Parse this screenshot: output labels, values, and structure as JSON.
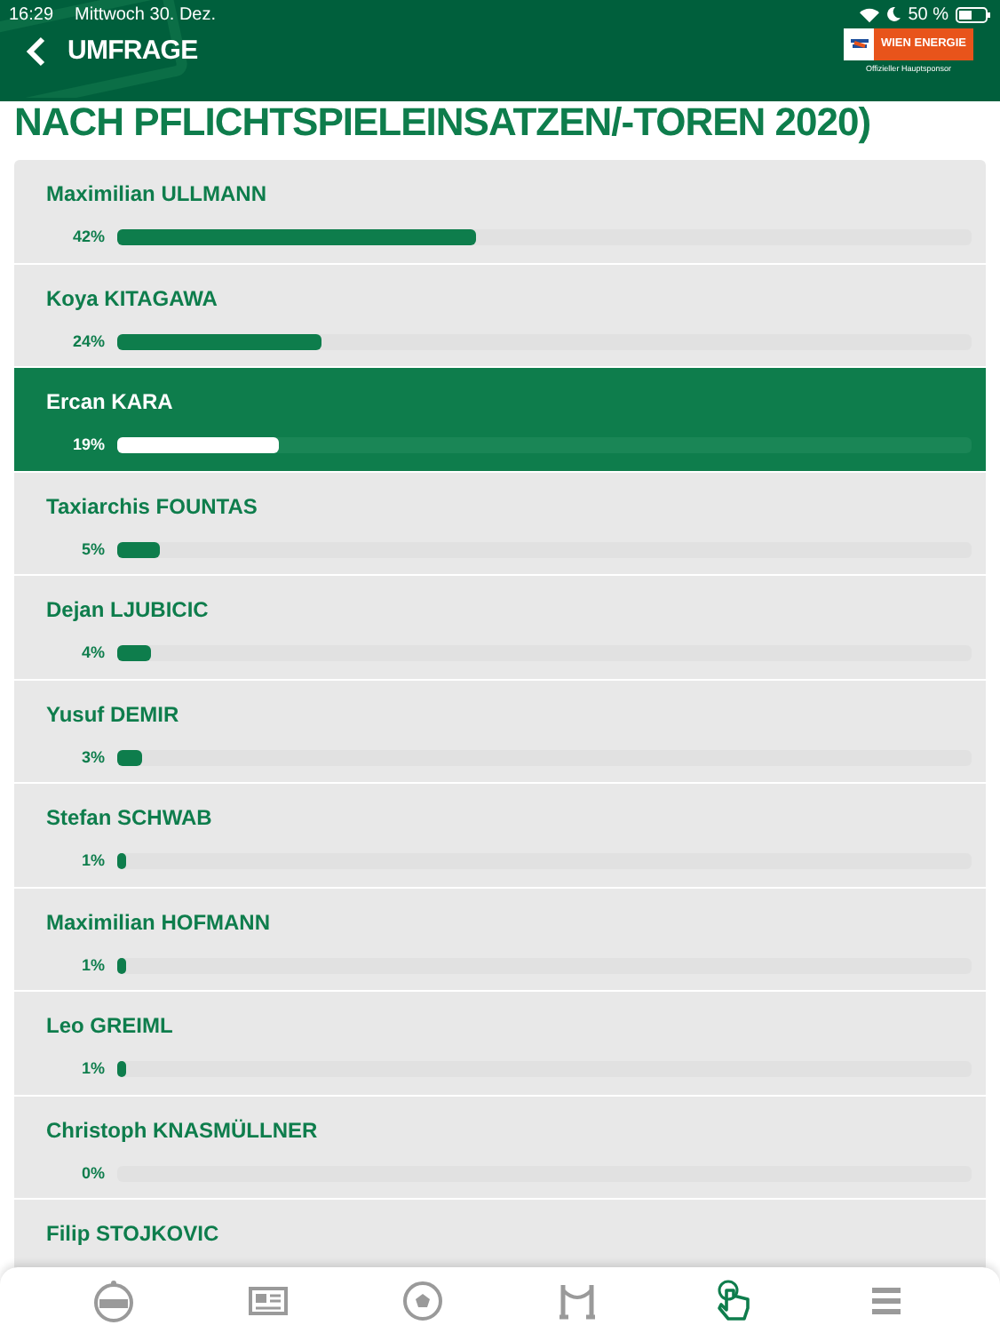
{
  "status_bar": {
    "time": "16:29",
    "date": "Mittwoch 30. Dez.",
    "battery": "50 %"
  },
  "header": {
    "title": "UMFRAGE",
    "sponsor": "WIEN ENERGIE",
    "sponsor_caption": "Offizieller Hauptsponsor"
  },
  "heading": "NACH PFLICHTSPIELEINSATZEN/-TOREN 2020)",
  "candidates": [
    {
      "name": "Maximilian ULLMANN",
      "percent": "42%",
      "level": 0.42,
      "selected": false
    },
    {
      "name": "Koya KITAGAWA",
      "percent": "24%",
      "level": 0.24,
      "selected": false
    },
    {
      "name": "Ercan KARA",
      "percent": "19%",
      "level": 0.19,
      "selected": true
    },
    {
      "name": "Taxiarchis FOUNTAS",
      "percent": "5%",
      "level": 0.05,
      "selected": false
    },
    {
      "name": "Dejan LJUBICIC",
      "percent": "4%",
      "level": 0.04,
      "selected": false
    },
    {
      "name": "Yusuf DEMIR",
      "percent": "3%",
      "level": 0.03,
      "selected": false
    },
    {
      "name": "Stefan SCHWAB",
      "percent": "1%",
      "level": 0.01,
      "selected": false
    },
    {
      "name": "Maximilian HOFMANN",
      "percent": "1%",
      "level": 0.01,
      "selected": false
    },
    {
      "name": "Leo GREIML",
      "percent": "1%",
      "level": 0.01,
      "selected": false
    },
    {
      "name": "Christoph KNASMÜLLNER",
      "percent": "0%",
      "selected": false
    },
    {
      "name": "Filip STOJKOVIC",
      "selected": false
    }
  ],
  "tab_bar": [
    {
      "kind": "club",
      "selected": false
    },
    {
      "kind": "news",
      "selected": false
    },
    {
      "kind": "ball",
      "selected": false
    },
    {
      "kind": "rope",
      "selected": false
    },
    {
      "kind": "poll",
      "selected": true
    },
    {
      "kind": "menu",
      "selected": false
    }
  ]
}
